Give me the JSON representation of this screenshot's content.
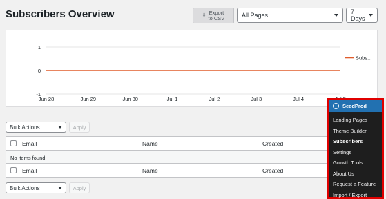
{
  "header": {
    "title": "Subscribers Overview",
    "export_line1": "Export",
    "export_line2": "to CSV",
    "pages_select": "All Pages",
    "days_select": "7 Days"
  },
  "chart_data": {
    "type": "line",
    "x": [
      "Jun 28",
      "Jun 29",
      "Jun 30",
      "Jul 1",
      "Jul 2",
      "Jul 3",
      "Jul 4",
      "Jul 5"
    ],
    "series": [
      {
        "name": "Subs...",
        "values": [
          0,
          0,
          0,
          0,
          0,
          0,
          0,
          0
        ],
        "color": "#e05d2c"
      }
    ],
    "yticks": [
      "1",
      "0",
      "-1"
    ],
    "ylim": [
      -1,
      1
    ],
    "legend": "top-right",
    "grid": true
  },
  "table": {
    "bulk_actions": "Bulk Actions",
    "apply": "Apply",
    "columns": [
      "Email",
      "Name",
      "Created"
    ],
    "empty_message": "No items found."
  },
  "seedprod_menu": {
    "brand": "SeedProd",
    "items": [
      "Landing Pages",
      "Theme Builder",
      "Subscribers",
      "Settings",
      "Growth Tools",
      "About Us",
      "Request a Feature",
      "Import / Export"
    ],
    "active": "Subscribers"
  },
  "colors": {
    "accent": "#2271b1",
    "line": "#e05d2c",
    "highlight": "#e00000"
  }
}
